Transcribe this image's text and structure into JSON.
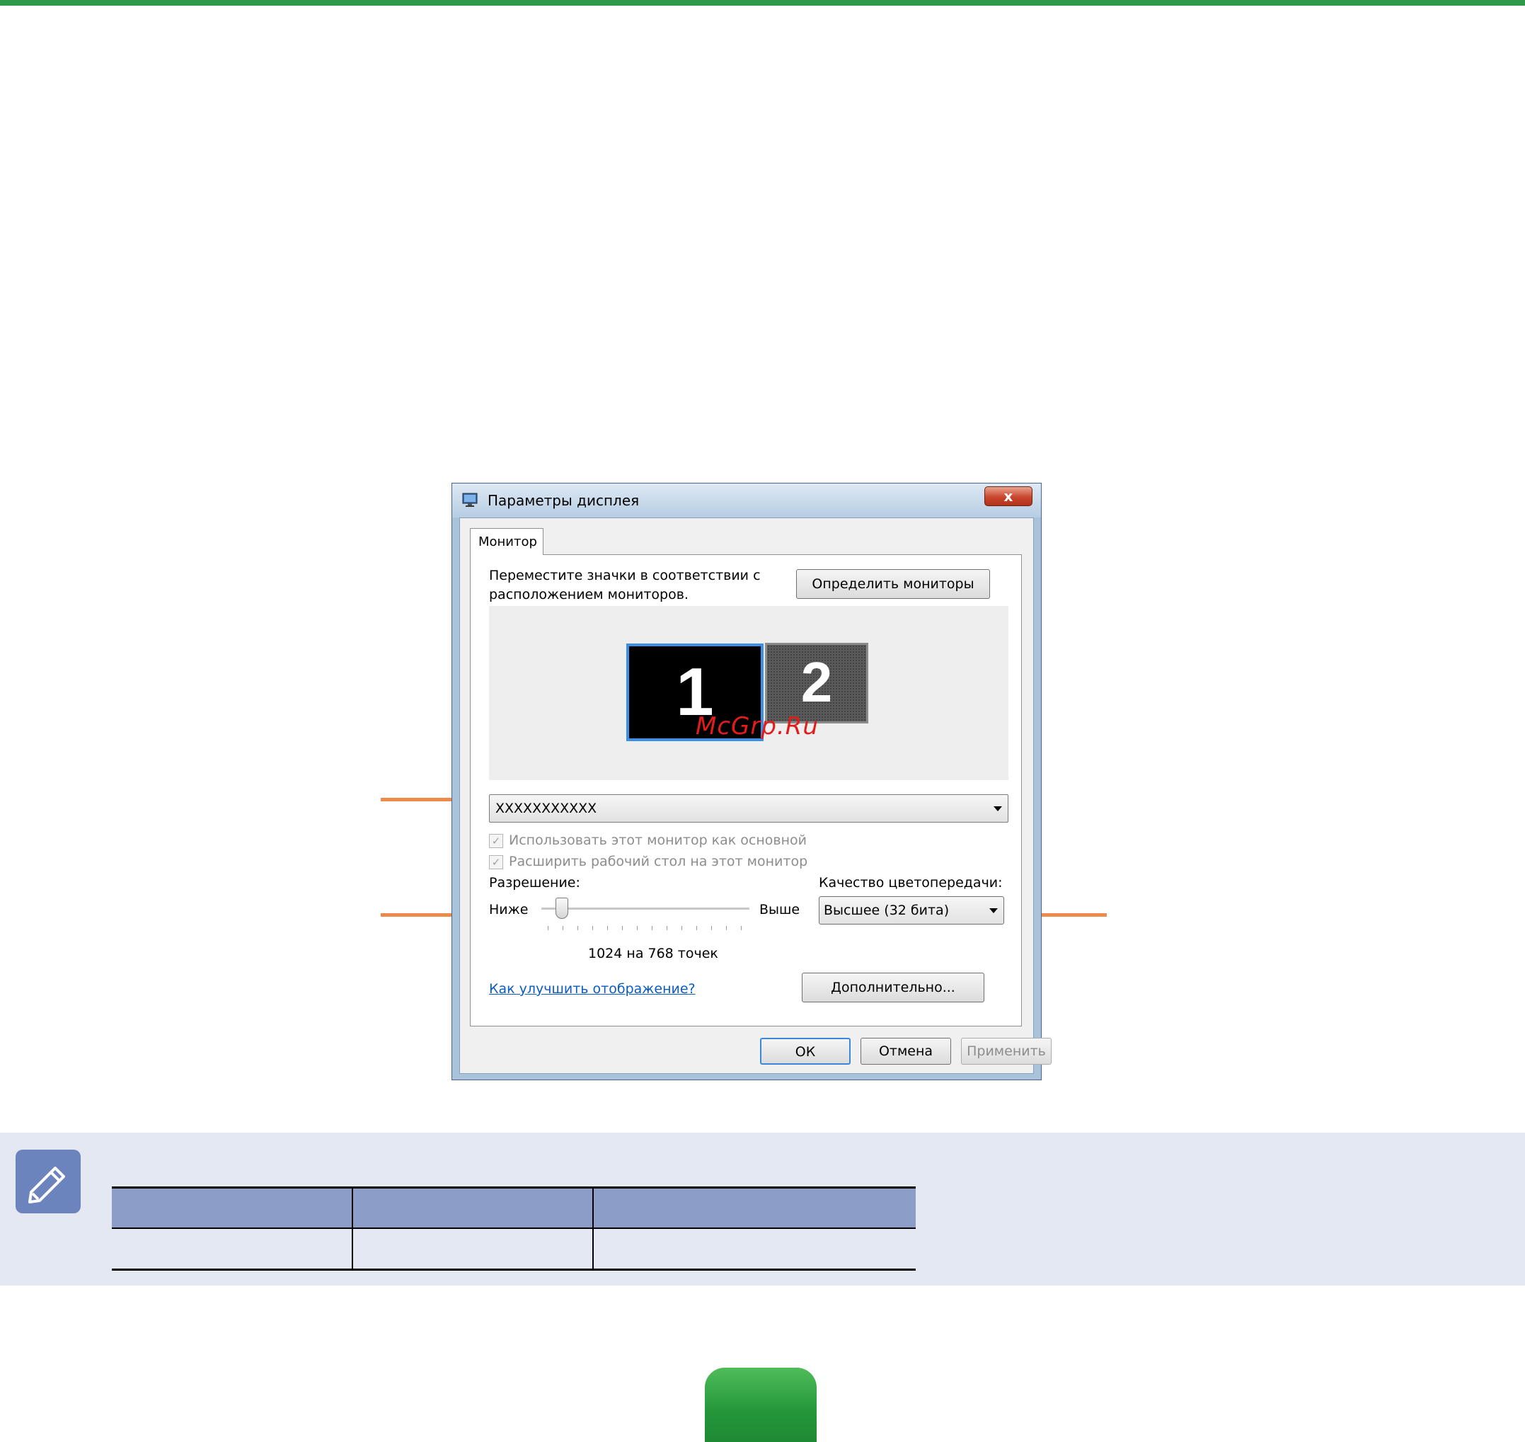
{
  "dialog": {
    "title": "Параметры дисплея",
    "close_glyph": "x",
    "tab_label": "Монитор",
    "instruction": "Переместите значки в соответствии с расположением мониторов.",
    "identify_button": "Определить мониторы",
    "monitors": [
      {
        "number": "1",
        "selected": true
      },
      {
        "number": "2",
        "selected": false
      }
    ],
    "watermark": "McGrp.Ru",
    "monitor_select_value": "XXXXXXXXXXX",
    "checkbox_primary": "Использовать этот монитор как основной",
    "checkbox_extend": "Расширить рабочий стол на этот монитор",
    "resolution_label": "Разрешение:",
    "slider_low": "Ниже",
    "slider_high": "Выше",
    "resolution_value": "1024 на 768 точек",
    "color_quality_label": "Качество цветопередачи:",
    "color_quality_value": "Высшее (32 бита)",
    "help_link": "Как улучшить отображение?",
    "advanced_button": "Дополнительно...",
    "ok_button": "ОК",
    "cancel_button": "Отмена",
    "apply_button": "Применить"
  },
  "colors": {
    "accent_green": "#2e9a49",
    "leader_orange": "#f08a4b",
    "note_bg": "#e4e8f2",
    "table_header": "#8c9ec8",
    "link": "#0a5bc4"
  },
  "icons": {
    "title": "display-settings-icon",
    "note": "pencil-note-icon"
  }
}
